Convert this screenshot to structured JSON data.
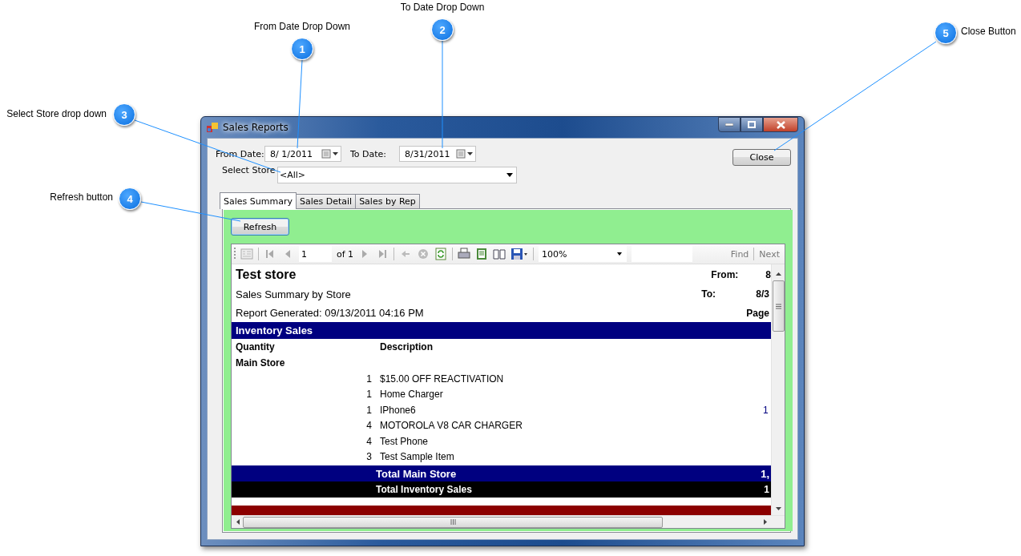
{
  "callouts": [
    {
      "number": "1",
      "label": "From Date Drop Down"
    },
    {
      "number": "2",
      "label": "To Date Drop Down"
    },
    {
      "number": "3",
      "label": "Select Store drop down"
    },
    {
      "number": "4",
      "label": "Refresh button"
    },
    {
      "number": "5",
      "label": "Close Button"
    }
  ],
  "window": {
    "title": "Sales Reports",
    "from_date": {
      "label": "From Date:",
      "value": "8/ 1/2011"
    },
    "to_date": {
      "label": "To Date:",
      "value": "8/31/2011"
    },
    "store": {
      "label": "Select Store",
      "value": "<All>"
    },
    "close_button": "Close",
    "tabs": [
      {
        "label": "Sales Summary",
        "selected": true
      },
      {
        "label": "Sales Detail",
        "selected": false
      },
      {
        "label": "Sales by Rep",
        "selected": false
      }
    ],
    "refresh_button": "Refresh",
    "report_toolbar": {
      "page": "1",
      "of_label": "of",
      "page_count": "1",
      "zoom": "100%",
      "find": "Find",
      "next": "Next"
    },
    "report": {
      "store_name": "Test store",
      "title": "Sales Summary by Store",
      "generated": "Report Generated: 09/13/2011 04:16 PM",
      "from_label": "From:",
      "from_value": "8",
      "to_label": "To:",
      "to_value": "8/3",
      "page_label": "Page",
      "section": "Inventory Sales",
      "columns": [
        "Quantity",
        "Description"
      ],
      "group": "Main Store",
      "rows": [
        {
          "quantity": "1",
          "description": "$15.00 OFF REACTIVATION"
        },
        {
          "quantity": "1",
          "description": "Home Charger"
        },
        {
          "quantity": "1",
          "description": "IPhone6",
          "column_3": "1"
        },
        {
          "quantity": "4",
          "description": "MOTOROLA V8 CAR CHARGER"
        },
        {
          "quantity": "4",
          "description": "Test Phone"
        },
        {
          "quantity": "3",
          "description": "Test Sample Item"
        }
      ],
      "group_total": {
        "label": "Total Main Store",
        "value": "1,"
      },
      "section_total": {
        "label": "Total Inventory Sales",
        "value": "1"
      }
    }
  }
}
